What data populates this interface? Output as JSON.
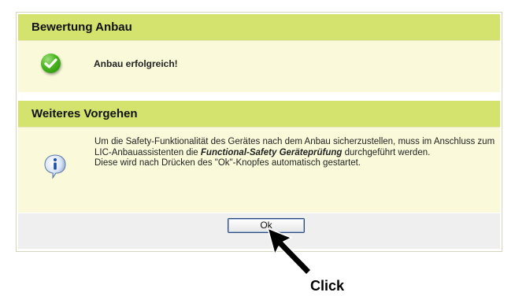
{
  "assessment": {
    "header": "Bewertung Anbau",
    "status_icon": "check-circle-icon",
    "status_text": "Anbau erfolgreich!"
  },
  "next_steps": {
    "header": "Weiteres Vorgehen",
    "info_icon": "info-icon",
    "line1_before": "Um die Safety-Funktionalität des Gerätes nach dem Anbau sicherzustellen, muss im Anschluss zum LIC-Anbauassistenten die ",
    "line1_emphasis": "Functional-Safety Geräteprüfung",
    "line1_after": " durchgeführt werden.",
    "line2": "Diese wird nach Drücken des \"Ok\"-Knopfes automatisch gestartet."
  },
  "footer": {
    "ok_label": "Ok"
  },
  "annotation": {
    "cursor_icon": "arrow-cursor-icon",
    "label": "Click"
  },
  "colors": {
    "header_bg": "#d4e36e",
    "body_bg": "#fafadb",
    "footer_bg": "#efefef"
  }
}
